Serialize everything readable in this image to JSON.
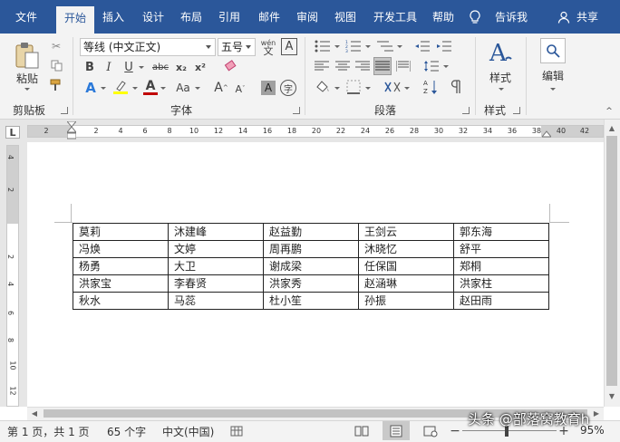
{
  "tabs": [
    "文件",
    "开始",
    "插入",
    "设计",
    "布局",
    "引用",
    "邮件",
    "审阅",
    "视图",
    "开发工具",
    "帮助"
  ],
  "active_tab": "开始",
  "tell_me": "告诉我",
  "share": "共享",
  "clipboard": {
    "paste_label": "粘贴",
    "group_label": "剪贴板"
  },
  "font": {
    "name": "等线 (中文正文)",
    "size": "五号",
    "group_label": "字体",
    "phonetic_glyph": "wén",
    "buttons": [
      "B",
      "I",
      "U",
      "abc",
      "x₂",
      "x²",
      "A",
      "Aa",
      "A",
      "A",
      "A",
      "字"
    ]
  },
  "paragraph": {
    "group_label": "段落"
  },
  "styles": {
    "label": "样式",
    "group_label": "样式"
  },
  "editing": {
    "label": "编辑"
  },
  "ruler": {
    "h_ticks": [
      "2",
      "2",
      "4",
      "6",
      "8",
      "10",
      "12",
      "14",
      "16",
      "18",
      "20",
      "22",
      "24",
      "26",
      "28",
      "30",
      "32",
      "34",
      "36",
      "38",
      "40",
      "42"
    ],
    "v_ticks": [
      "4",
      "2",
      "2",
      "4",
      "6",
      "8",
      "10",
      "12"
    ],
    "tab_selector": "L"
  },
  "table": {
    "rows": [
      [
        "莫莉",
        "沐建峰",
        "赵益勤",
        "王剑云",
        "郭东海"
      ],
      [
        "冯焕",
        "文婷",
        "周再鹏",
        "沐晓忆",
        "舒平"
      ],
      [
        "杨勇",
        "大卫",
        "谢成梁",
        "任保国",
        "郑桐"
      ],
      [
        "洪家宝",
        "李春贤",
        "洪家秀",
        "赵涵琳",
        "洪家柱"
      ],
      [
        "秋水",
        "马蕊",
        "杜小笙",
        "孙振",
        "赵田雨"
      ]
    ]
  },
  "statusbar": {
    "page": "第 1 页，共 1 页",
    "words": "65 个字",
    "language": "中文(中国)",
    "zoom": "95%",
    "minus": "−",
    "plus": "+"
  },
  "watermark": "头条 @部落窝教育h",
  "colors": {
    "ribbon_blue": "#2b579a",
    "accent": "#2b579a",
    "highlight_yellow": "#ffff00",
    "font_red": "#c00000"
  }
}
